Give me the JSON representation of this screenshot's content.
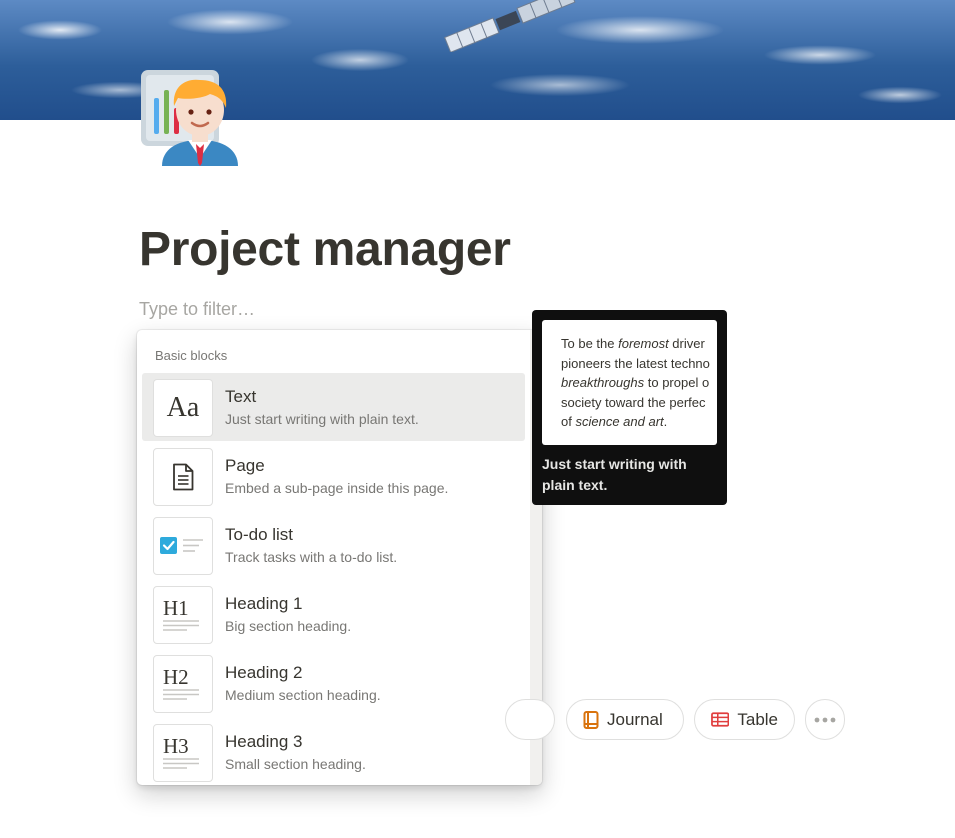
{
  "page": {
    "title": "Project manager",
    "filter_placeholder": "Type to filter…",
    "icon": "man-technologist-presenter-icon",
    "cover": "space-satellite-over-earth-cover"
  },
  "menu": {
    "section_label": "Basic blocks",
    "selected_index": 0,
    "items": [
      {
        "title": "Text",
        "description": "Just start writing with plain text.",
        "icon": "text-aa-icon"
      },
      {
        "title": "Page",
        "description": "Embed a sub-page inside this page.",
        "icon": "page-document-icon"
      },
      {
        "title": "To-do list",
        "description": "Track tasks with a to-do list.",
        "icon": "checkbox-icon"
      },
      {
        "title": "Heading 1",
        "description": "Big section heading.",
        "icon": "heading-1-icon"
      },
      {
        "title": "Heading 2",
        "description": "Medium section heading.",
        "icon": "heading-2-icon"
      },
      {
        "title": "Heading 3",
        "description": "Small section heading.",
        "icon": "heading-3-icon"
      }
    ]
  },
  "preview": {
    "lines": [
      {
        "a": "To be the ",
        "b": "foremost",
        "c": " driver"
      },
      {
        "a": "pioneers the latest techno",
        "b": "",
        "c": ""
      },
      {
        "a": "",
        "b": "breakthroughs",
        "c": " to propel o"
      },
      {
        "a": "society toward the perfec",
        "b": "",
        "c": ""
      },
      {
        "a": "of ",
        "b": "science and art",
        "c": "."
      }
    ],
    "caption": "Just start writing with plain text."
  },
  "template_pills": {
    "journal": "Journal",
    "table": "Table",
    "more": "more-horizontal-icon"
  },
  "colors": {
    "accent_blue": "#2eaadc",
    "journal_orange": "#d9730d",
    "table_red": "#e03e3e",
    "tooltip_bg": "#0f0f0f"
  }
}
